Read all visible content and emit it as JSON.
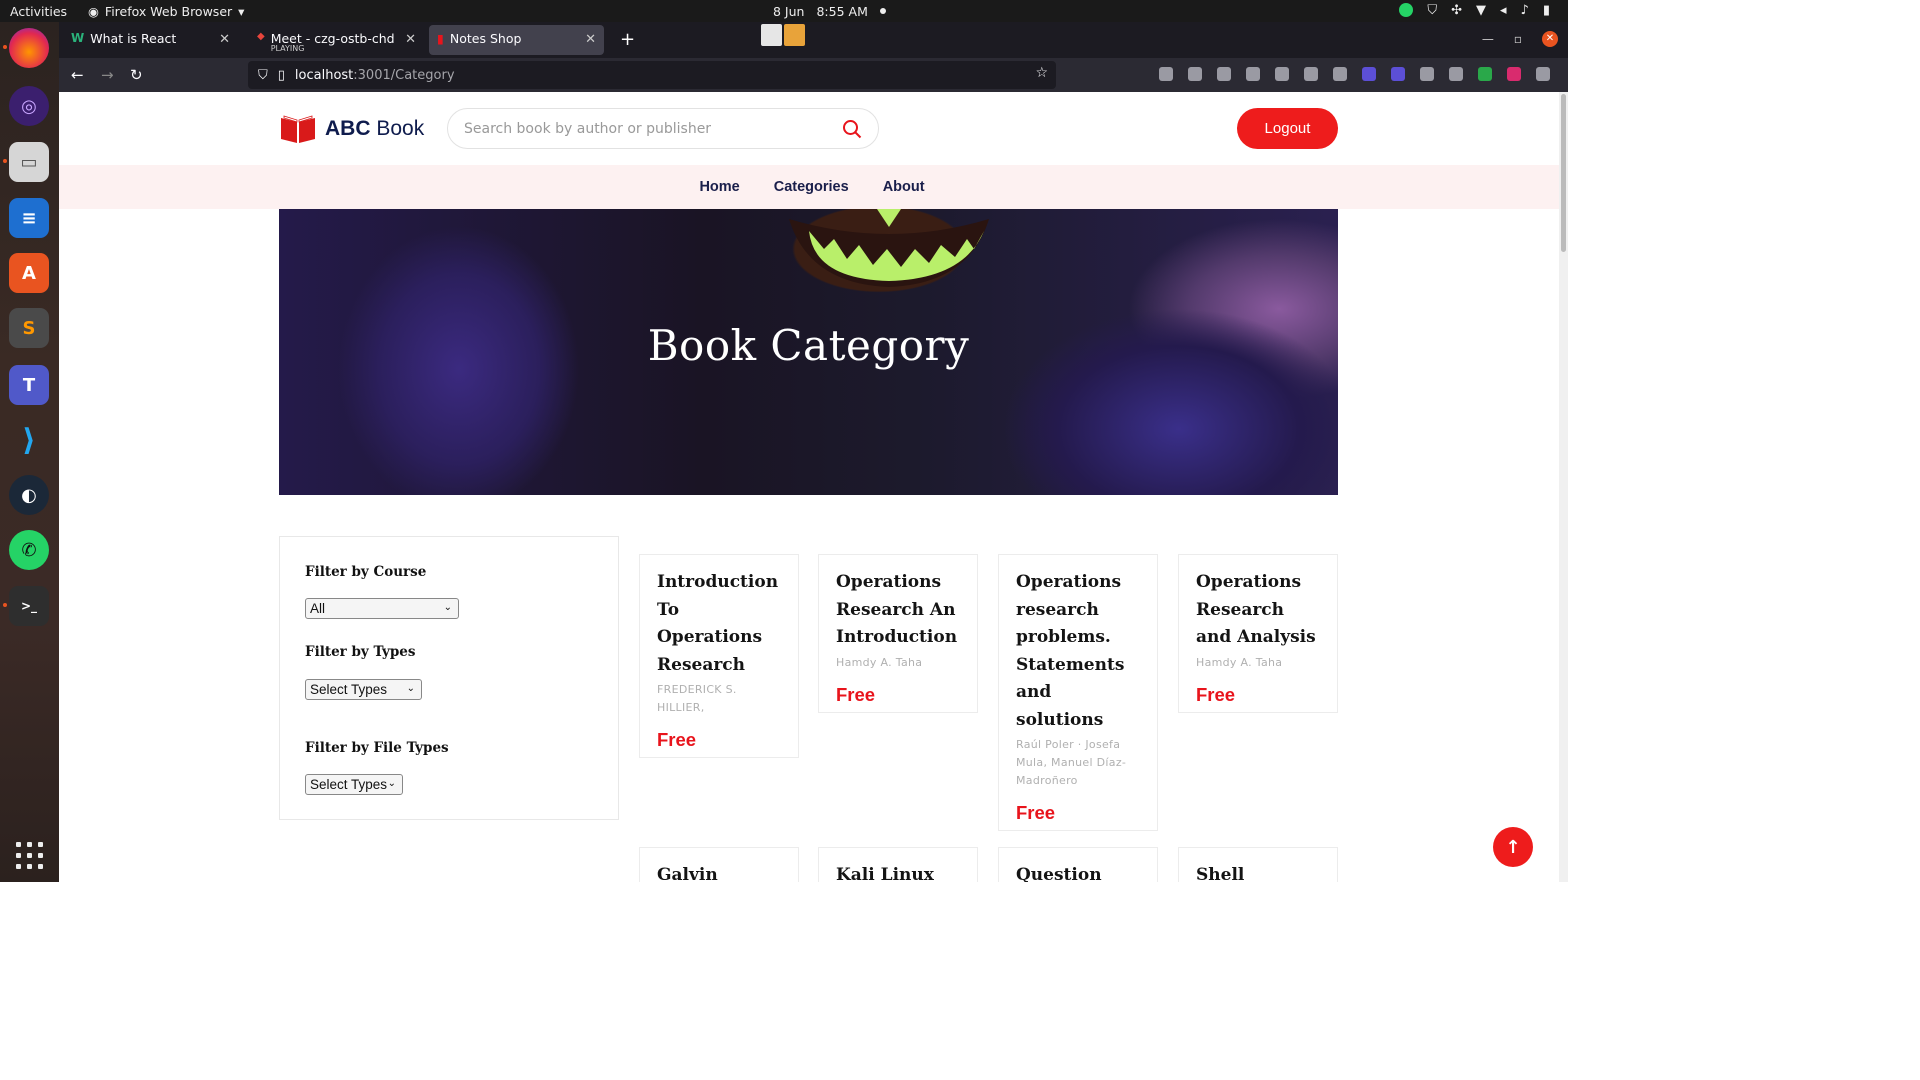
{
  "system": {
    "activities": "Activities",
    "app_menu": "Firefox Web Browser",
    "date": "8 Jun",
    "time": "8:55 AM"
  },
  "browser": {
    "tabs": [
      {
        "label": "What is React",
        "favicon": "w-icon"
      },
      {
        "label": "Meet - czg-ostb-chd",
        "sublabel": "PLAYING",
        "favicon": "meet-icon"
      },
      {
        "label": "Notes Shop",
        "favicon": "book-icon",
        "selected": true
      }
    ],
    "url_host": "localhost",
    "url_path": ":3001/Category"
  },
  "site": {
    "brand_bold": "ABC",
    "brand_light": "Book",
    "search_placeholder": "Search book by author or publisher",
    "logout_label": "Logout",
    "nav": [
      "Home",
      "Categories",
      "About"
    ],
    "hero_title": "Book Category",
    "filters": {
      "course_label": "Filter by Course",
      "course_value": "All",
      "types_label": "Filter by Types",
      "types_value": "Select Types",
      "file_types_label": "Filter by File Types",
      "file_types_value": "Select Types"
    },
    "books": [
      {
        "title": "Introduction To Operations Research",
        "author": "FREDERICK S. HILLIER,",
        "price": "Free"
      },
      {
        "title": "Operations Research An Introduction",
        "author": "Hamdy A. Taha",
        "price": "Free"
      },
      {
        "title": "Operations research problems. Statements and solutions",
        "author": "Raúl Poler · Josefa Mula, Manuel Díaz-Madroñero",
        "price": "Free"
      },
      {
        "title": "Operations Research and Analysis",
        "author": "Hamdy A. Taha",
        "price": "Free"
      },
      {
        "title": "Galvin",
        "author": "",
        "price": ""
      },
      {
        "title": "Kali Linux",
        "author": "",
        "price": ""
      },
      {
        "title": "Question Bank",
        "author": "",
        "price": ""
      },
      {
        "title": "Shell Scripting",
        "author": "",
        "price": ""
      }
    ]
  },
  "colors": {
    "accent": "#ee1c1c",
    "brand_navy": "#0f1c4d",
    "nav_bg": "#fdf1f1"
  }
}
